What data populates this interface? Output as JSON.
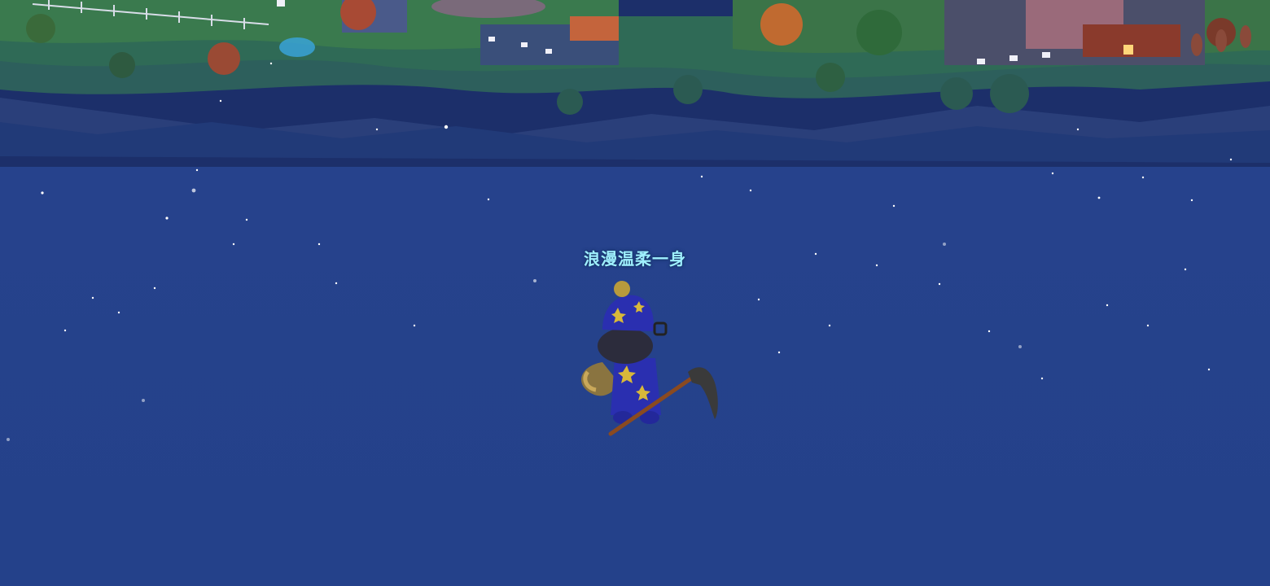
{
  "player": {
    "name": "浪漫温柔一身"
  },
  "colors": {
    "sky": "#25418b",
    "name_text": "#9ff0ff",
    "hills_dark": "#1f3a6e",
    "grass": "#2e6a55"
  },
  "icons": {
    "avatar": "wizard-raccoon-character",
    "tool": "hoe-icon"
  }
}
